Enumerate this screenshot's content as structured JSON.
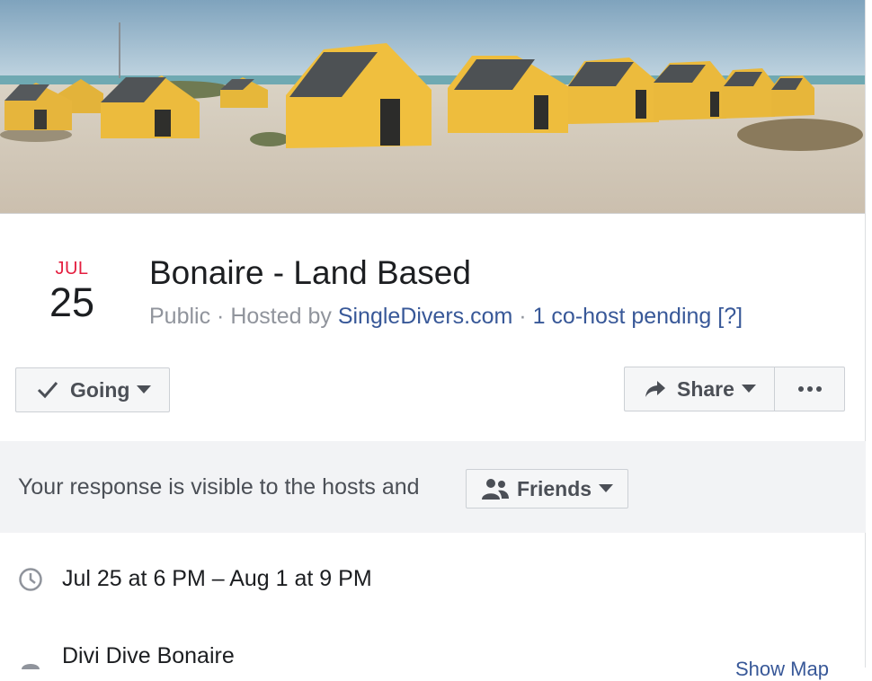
{
  "event": {
    "date": {
      "month": "JUL",
      "day": "25"
    },
    "title": "Bonaire - Land Based",
    "privacy": "Public",
    "separator": " · ",
    "hosted_by_prefix": "Hosted by ",
    "host": "SingleDivers.com",
    "cohost": "1 co-host pending [?]"
  },
  "actions": {
    "going_label": "Going",
    "share_label": "Share"
  },
  "response": {
    "text": "Your response is visible to the hosts and",
    "audience_label": "Friends"
  },
  "details": {
    "time": "Jul 25 at 6 PM – Aug 1 at 9 PM",
    "location": "Divi Dive Bonaire",
    "show_more": "Show Map"
  },
  "colors": {
    "month_red": "#e41e3f",
    "link_blue": "#385898",
    "muted_gray": "#90949c",
    "panel_gray": "#f2f3f5"
  },
  "icons": {
    "going": "check-icon",
    "share": "share-arrow-icon",
    "more": "more-dots-icon",
    "audience": "friends-icon",
    "time": "clock-icon",
    "location": "pin-icon"
  }
}
